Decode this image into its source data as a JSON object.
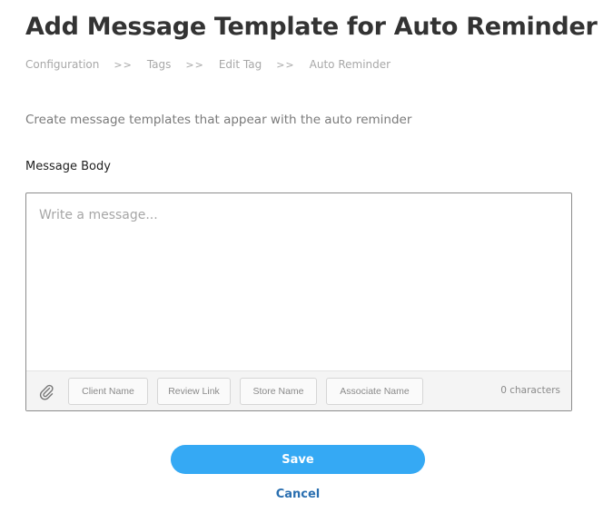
{
  "page": {
    "title": "Add Message Template for Auto Reminder",
    "subtitle": "Create message templates that appear with the auto reminder"
  },
  "breadcrumb": {
    "separator": ">>",
    "items": [
      "Configuration",
      "Tags",
      "Edit Tag",
      "Auto Reminder"
    ]
  },
  "form": {
    "message_body_label": "Message Body",
    "message_placeholder": "Write a message...",
    "message_value": "",
    "chips": [
      "Client Name",
      "Review Link",
      "Store Name",
      "Associate Name"
    ],
    "character_count": "0 characters",
    "attach_icon": "paperclip-icon"
  },
  "actions": {
    "save_label": "Save",
    "cancel_label": "Cancel"
  },
  "colors": {
    "accent": "#35a9f4",
    "link": "#2a6fb0",
    "title": "#333333"
  }
}
